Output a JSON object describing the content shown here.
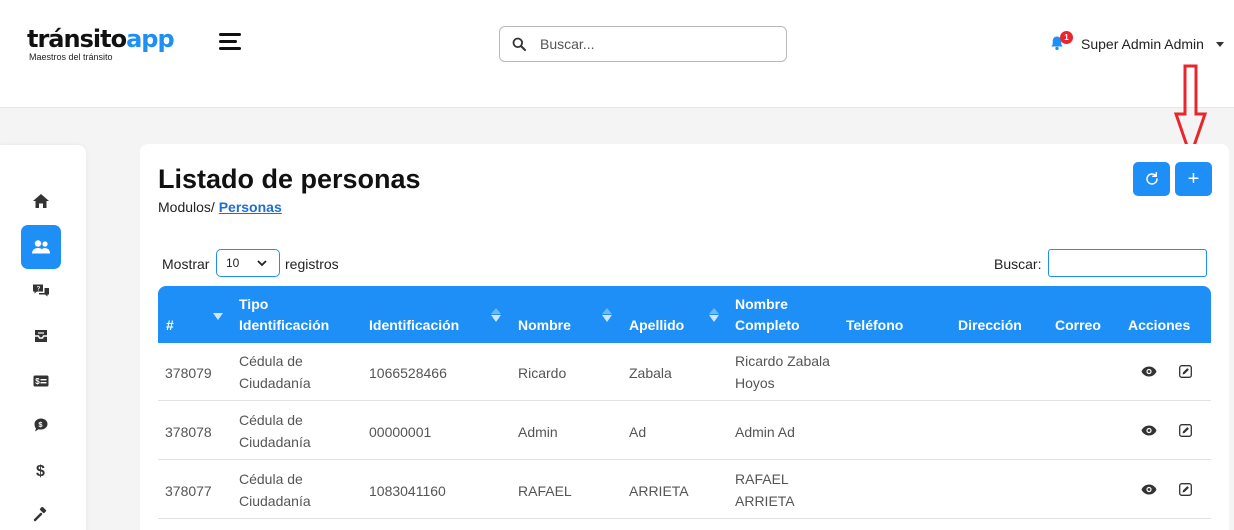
{
  "header": {
    "logo_part1": "tránsito",
    "logo_part2": "app",
    "logo_subtitle": "Maestros del tránsito",
    "search_placeholder": "Buscar...",
    "notification_count": "1",
    "user_name": "Super Admin Admin"
  },
  "sidebar": {
    "items": [
      {
        "icon": "home-icon",
        "active": false
      },
      {
        "icon": "users-icon",
        "active": true
      },
      {
        "icon": "chat-icon",
        "active": false
      },
      {
        "icon": "inbox-icon",
        "active": false
      },
      {
        "icon": "money-card-icon",
        "active": false
      },
      {
        "icon": "dollar-bubble-icon",
        "active": false
      },
      {
        "icon": "dollar-icon",
        "active": false
      },
      {
        "icon": "gavel-icon",
        "active": false
      }
    ]
  },
  "page": {
    "title": "Listado de personas",
    "breadcrumb_prefix": "Modulos/",
    "breadcrumb_current": "Personas",
    "add_label": "+"
  },
  "table_controls": {
    "show_label": "Mostrar",
    "page_size": "10",
    "show_suffix": "registros",
    "search_label": "Buscar:"
  },
  "table": {
    "headers": {
      "num": "#",
      "tipo1": "Tipo",
      "tipo2": "Identificación",
      "identificacion": "Identificación",
      "nombre": "Nombre",
      "apellido": "Apellido",
      "nc1": "Nombre",
      "nc2": "Completo",
      "telefono": "Teléfono",
      "direccion": "Dirección",
      "correo": "Correo",
      "acciones": "Acciones"
    },
    "rows": [
      {
        "id": "378079",
        "tipo1": "Cédula de",
        "tipo2": "Ciudadanía",
        "identificacion": "1066528466",
        "nombre": "Ricardo",
        "apellido": "Zabala",
        "nc1": "Ricardo Zabala",
        "nc2": "Hoyos",
        "telefono": "",
        "direccion": "",
        "correo": ""
      },
      {
        "id": "378078",
        "tipo1": "Cédula de",
        "tipo2": "Ciudadanía",
        "identificacion": "00000001",
        "nombre": "Admin",
        "apellido": "Ad",
        "nc1": "Admin Ad",
        "nc2": "",
        "telefono": "",
        "direccion": "",
        "correo": ""
      },
      {
        "id": "378077",
        "tipo1": "Cédula de",
        "tipo2": "Ciudadanía",
        "identificacion": "1083041160",
        "nombre": "RAFAEL",
        "apellido": "ARRIETA",
        "nc1": "RAFAEL",
        "nc2": "ARRIETA",
        "telefono": "",
        "direccion": "",
        "correo": ""
      }
    ]
  },
  "colors": {
    "accent": "#1e8ff7",
    "annotation_arrow": "#e8262c"
  }
}
